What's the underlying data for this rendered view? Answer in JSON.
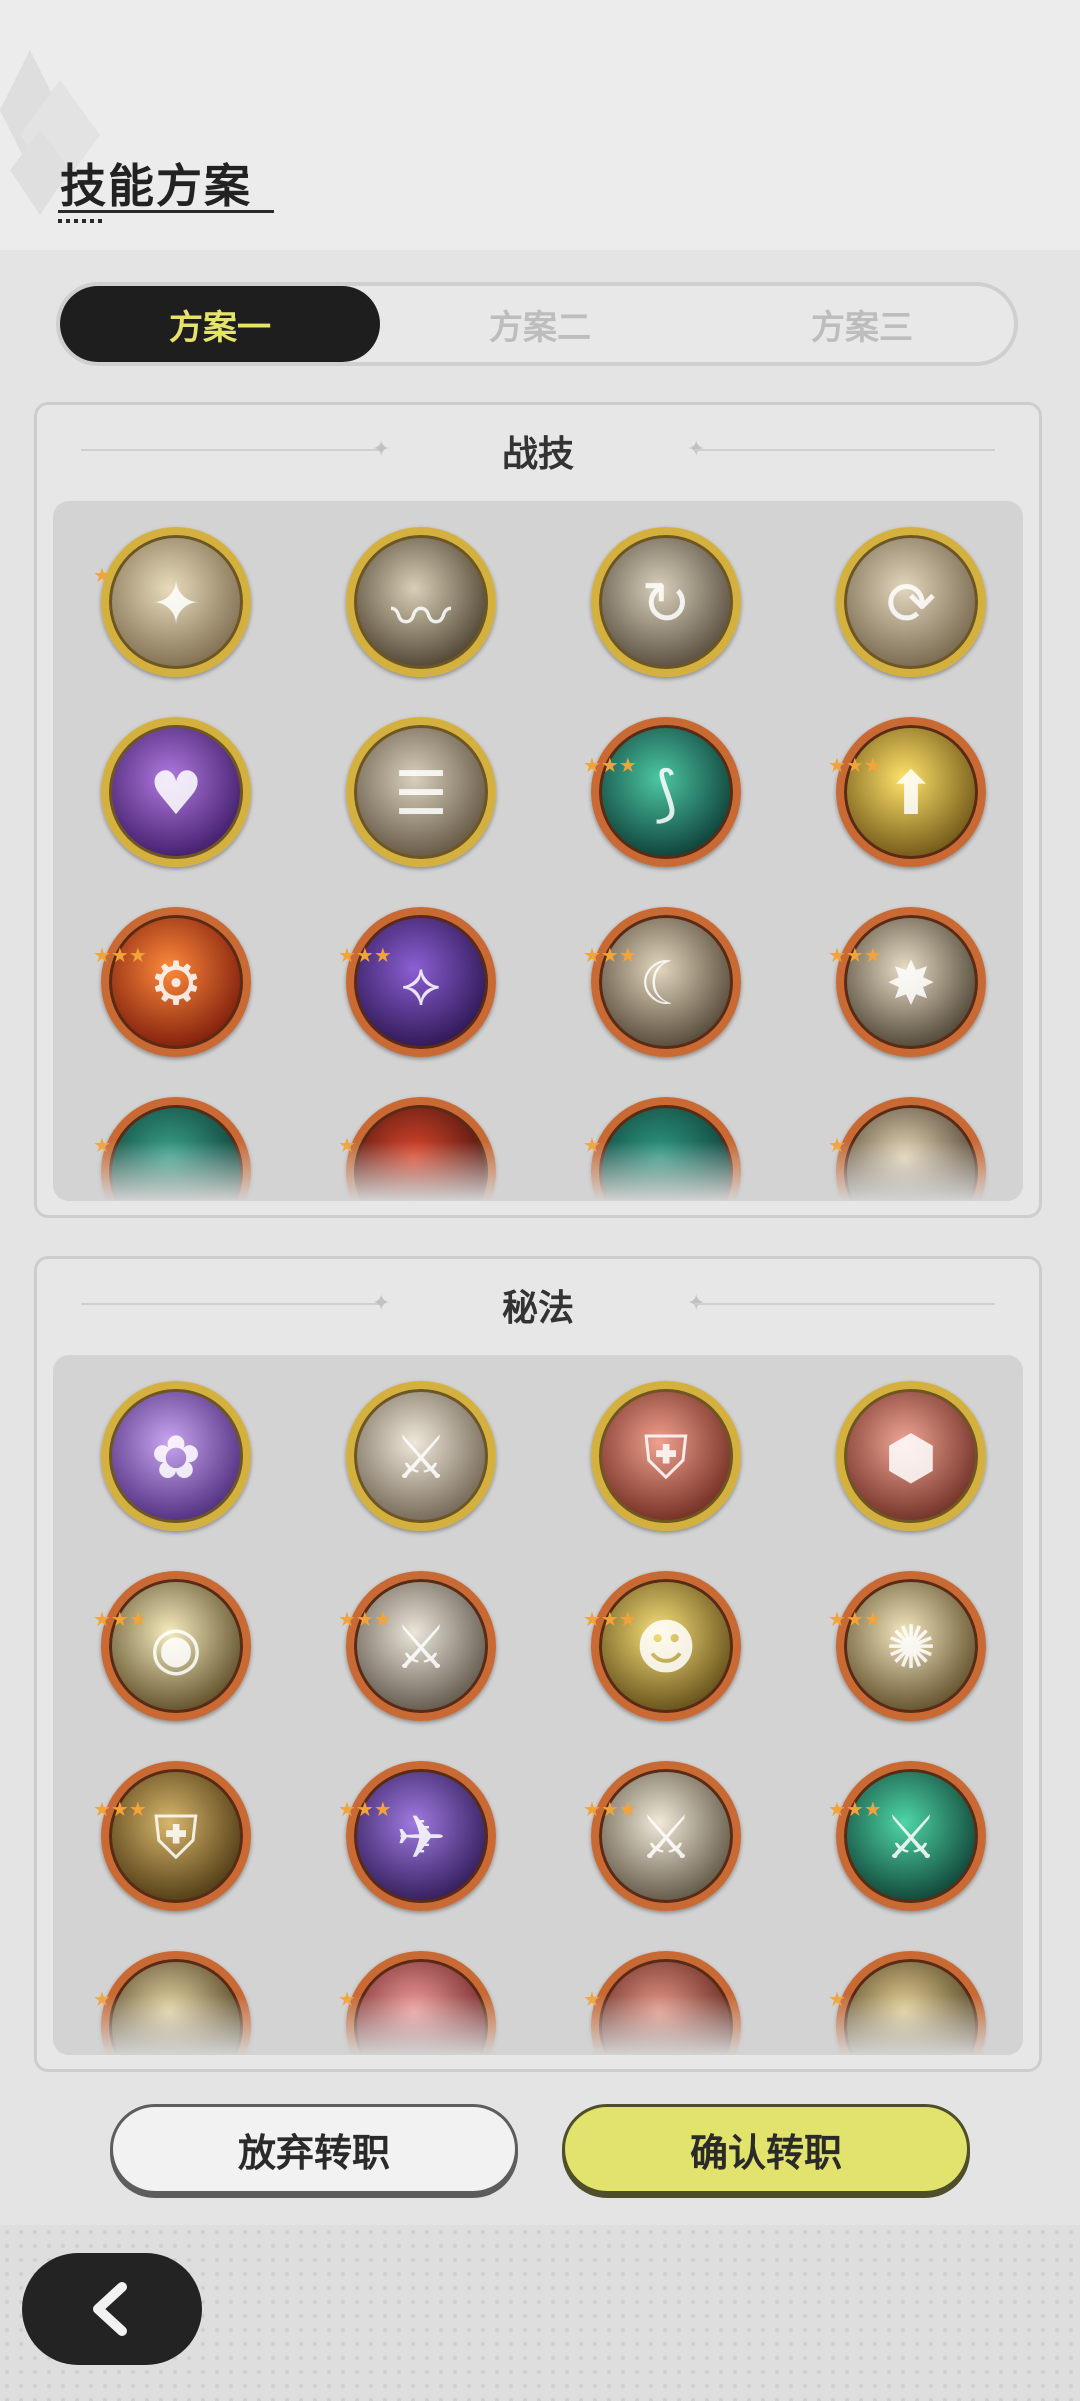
{
  "header": {
    "title": "技能方案"
  },
  "tabs": [
    {
      "label": "方案一",
      "active": true
    },
    {
      "label": "方案二",
      "active": false
    },
    {
      "label": "方案三",
      "active": false
    }
  ],
  "combat_skills": {
    "title": "战技",
    "rows": [
      [
        {
          "ring": "gold",
          "colors": [
            "#e8dcbc",
            "#7c6a4d"
          ],
          "glyph": "✦",
          "stars": 1
        },
        {
          "ring": "gold",
          "colors": [
            "#d9cfb7",
            "#4a3f2d"
          ],
          "glyph": "〰",
          "stars": 0
        },
        {
          "ring": "gold",
          "colors": [
            "#d8d0bb",
            "#54493a"
          ],
          "glyph": "↻",
          "stars": 0
        },
        {
          "ring": "gold",
          "colors": [
            "#e2d6bd",
            "#73644a"
          ],
          "glyph": "⟳",
          "stars": 0
        }
      ],
      [
        {
          "ring": "gold",
          "colors": [
            "#b07ae0",
            "#3d1a66"
          ],
          "glyph": "♥",
          "stars": 0
        },
        {
          "ring": "gold",
          "colors": [
            "#d8cfbd",
            "#5f533f"
          ],
          "glyph": "☰",
          "stars": 0
        },
        {
          "ring": "orange",
          "colors": [
            "#4cc7a3",
            "#0c3a33"
          ],
          "glyph": "⟆",
          "stars": 3
        },
        {
          "ring": "orange",
          "colors": [
            "#ffe36b",
            "#6b5114"
          ],
          "glyph": "⬆",
          "stars": 3
        }
      ],
      [
        {
          "ring": "orange",
          "colors": [
            "#ff8a3c",
            "#7a1a0a"
          ],
          "glyph": "⚙",
          "stars": 3
        },
        {
          "ring": "orange",
          "colors": [
            "#8c5fd3",
            "#2a1550"
          ],
          "glyph": "⟡",
          "stars": 3
        },
        {
          "ring": "orange",
          "colors": [
            "#e2d6bd",
            "#4f4433"
          ],
          "glyph": "☾",
          "stars": 3
        },
        {
          "ring": "orange",
          "colors": [
            "#e7ddc6",
            "#4a4030"
          ],
          "glyph": "✸",
          "stars": 3
        }
      ],
      [
        {
          "ring": "orange",
          "colors": [
            "#3aa58c",
            "#0d3a33"
          ],
          "glyph": "",
          "stars": 1
        },
        {
          "ring": "orange",
          "colors": [
            "#e0472c",
            "#40120d"
          ],
          "glyph": "",
          "stars": 1
        },
        {
          "ring": "orange",
          "colors": [
            "#2f9c84",
            "#0d3a33"
          ],
          "glyph": "",
          "stars": 1
        },
        {
          "ring": "orange",
          "colors": [
            "#e8dcbc",
            "#4a3a2a"
          ],
          "glyph": "",
          "stars": 1
        }
      ]
    ]
  },
  "secret_arts": {
    "title": "秘法",
    "rows": [
      [
        {
          "ring": "gold",
          "colors": [
            "#c9a5f0",
            "#4b2a7a"
          ],
          "glyph": "✿",
          "stars": 0
        },
        {
          "ring": "gold",
          "colors": [
            "#efe8da",
            "#6e6251"
          ],
          "glyph": "⚔",
          "stars": 0
        },
        {
          "ring": "gold",
          "colors": [
            "#f0a08e",
            "#6e2a1e"
          ],
          "glyph": "⛨",
          "stars": 0
        },
        {
          "ring": "gold",
          "colors": [
            "#efa594",
            "#6c2c22"
          ],
          "glyph": "⬢",
          "stars": 0
        }
      ],
      [
        {
          "ring": "orange",
          "colors": [
            "#f5ecbf",
            "#5a4a23"
          ],
          "glyph": "◉",
          "stars": 3
        },
        {
          "ring": "orange",
          "colors": [
            "#ece6da",
            "#5b5346"
          ],
          "glyph": "⚔",
          "stars": 3
        },
        {
          "ring": "orange",
          "colors": [
            "#f7e07a",
            "#5e4a16"
          ],
          "glyph": "☻",
          "stars": 3
        },
        {
          "ring": "orange",
          "colors": [
            "#f3e7c0",
            "#5b4b26"
          ],
          "glyph": "✺",
          "stars": 3
        }
      ],
      [
        {
          "ring": "orange",
          "colors": [
            "#d8b66b",
            "#4a3712"
          ],
          "glyph": "⛨",
          "stars": 3
        },
        {
          "ring": "orange",
          "colors": [
            "#a07ae0",
            "#2d1a55"
          ],
          "glyph": "✈",
          "stars": 3
        },
        {
          "ring": "orange",
          "colors": [
            "#f1ead9",
            "#5b5140"
          ],
          "glyph": "⚔",
          "stars": 3
        },
        {
          "ring": "orange",
          "colors": [
            "#4fd6a7",
            "#0e3e32"
          ],
          "glyph": "⚔",
          "stars": 3
        }
      ],
      [
        {
          "ring": "orange",
          "colors": [
            "#e8d9a8",
            "#4a3b1c"
          ],
          "glyph": "",
          "stars": 1
        },
        {
          "ring": "orange",
          "colors": [
            "#f2a0a0",
            "#6a2020"
          ],
          "glyph": "",
          "stars": 1
        },
        {
          "ring": "orange",
          "colors": [
            "#e89a8a",
            "#5a2018"
          ],
          "glyph": "",
          "stars": 1
        },
        {
          "ring": "orange",
          "colors": [
            "#e8d49a",
            "#4a3b1c"
          ],
          "glyph": "",
          "stars": 1
        }
      ]
    ]
  },
  "actions": {
    "abandon_label": "放弃转职",
    "confirm_label": "确认转职"
  },
  "nav": {
    "back_icon": "chevron-left-icon"
  },
  "colors": {
    "accent": "#e2e36d",
    "tab_active_bg": "#1e1e1e",
    "tab_active_text": "#e6e36a"
  }
}
